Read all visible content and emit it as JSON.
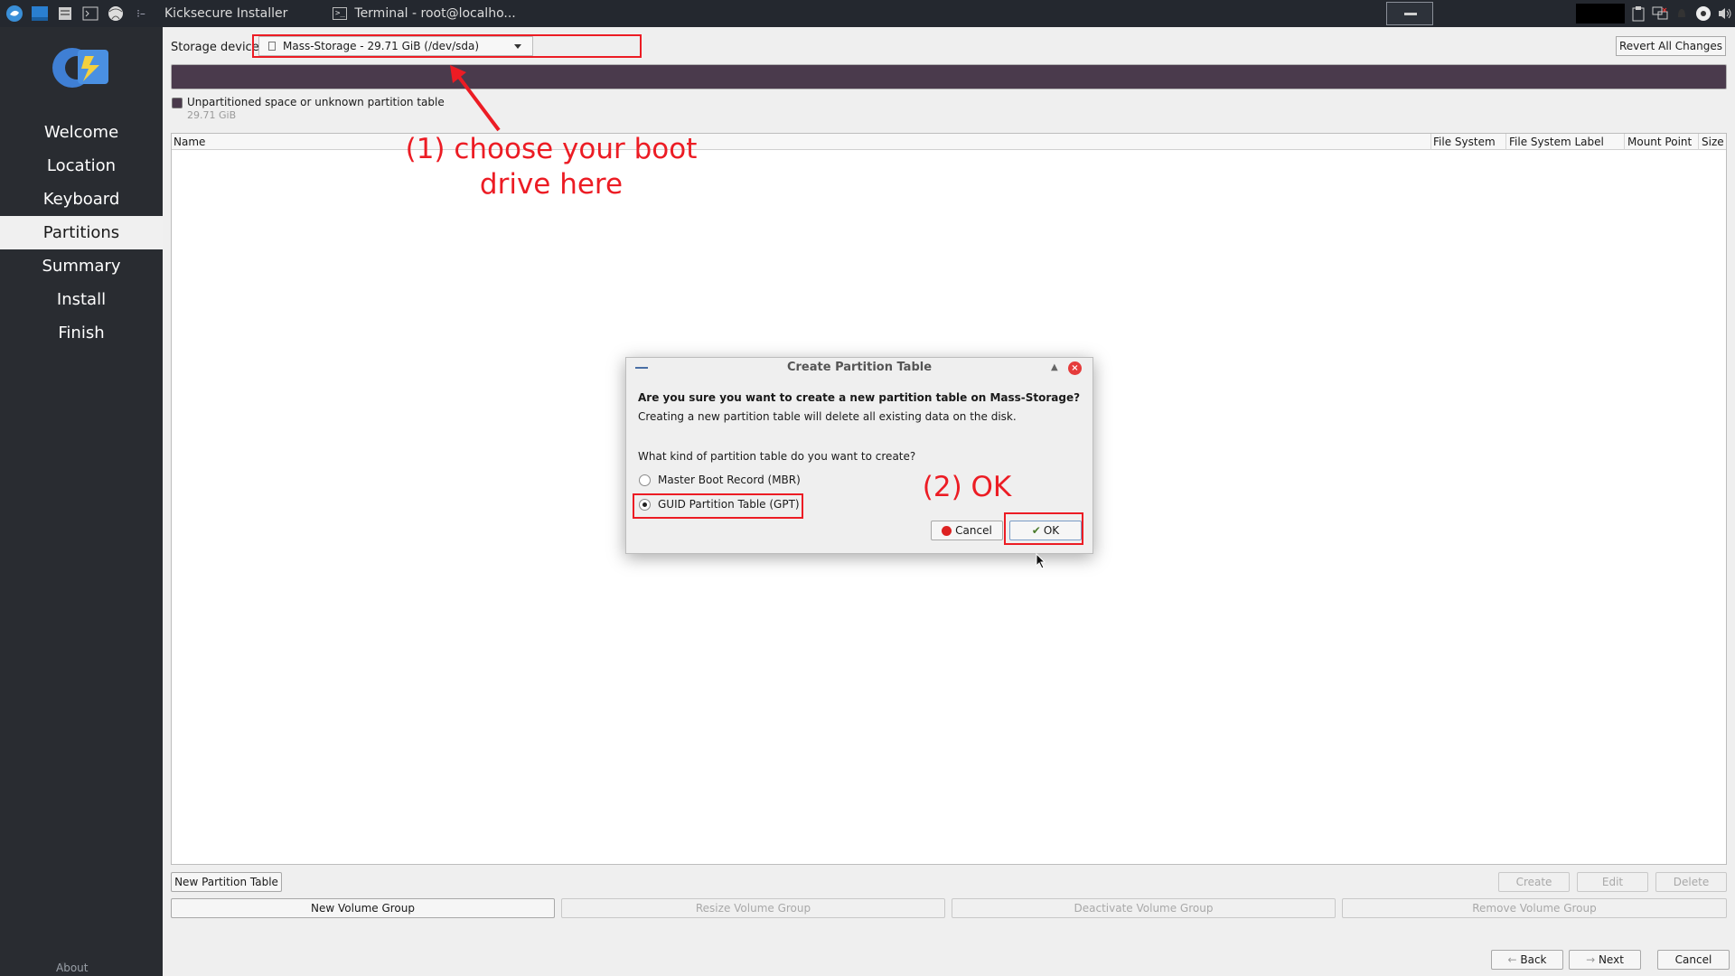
{
  "taskbar": {
    "tasks": [
      {
        "label": "Kicksecure Installer"
      },
      {
        "label": "Terminal - root@localho..."
      }
    ],
    "terminal_glyph": ">_"
  },
  "sidebar": {
    "items": [
      {
        "label": "Welcome"
      },
      {
        "label": "Location"
      },
      {
        "label": "Keyboard"
      },
      {
        "label": "Partitions"
      },
      {
        "label": "Summary"
      },
      {
        "label": "Install"
      },
      {
        "label": "Finish"
      }
    ],
    "active_index": 3,
    "about_label": "About"
  },
  "storage": {
    "label": "Storage device",
    "device": "Mass-Storage - 29.71 GiB (/dev/sda)"
  },
  "revert_label": "Revert All Changes",
  "legend": {
    "label": "Unpartitioned space or unknown partition table",
    "size": "29.71 GiB",
    "color": "#4a3a4c"
  },
  "table": {
    "columns": [
      "Name",
      "File System",
      "File System Label",
      "Mount Point",
      "Size"
    ]
  },
  "buttons": {
    "new_partition_table": "New Partition Table",
    "create": "Create",
    "edit": "Edit",
    "delete": "Delete",
    "new_volume_group": "New Volume Group",
    "resize_volume_group": "Resize Volume Group",
    "deactivate_volume_group": "Deactivate Volume Group",
    "remove_volume_group": "Remove Volume Group",
    "back": "Back",
    "next": "Next",
    "cancel": "Cancel"
  },
  "dialog": {
    "title": "Create Partition Table",
    "question": "Are you sure you want to create a new partition table on Mass-Storage?",
    "warning": "Creating a new partition table will delete all existing data on the disk.",
    "kind_question": "What kind of partition table do you want to create?",
    "options": [
      {
        "label": "Master Boot Record (MBR)",
        "selected": false
      },
      {
        "label": "GUID Partition Table (GPT)",
        "selected": true
      }
    ],
    "cancel_label": "Cancel",
    "ok_label": "OK"
  },
  "annotations": {
    "step1_line1": "(1) choose your boot",
    "step1_line2": "drive here",
    "step2": "(2) OK",
    "color": "#ec1c24"
  }
}
